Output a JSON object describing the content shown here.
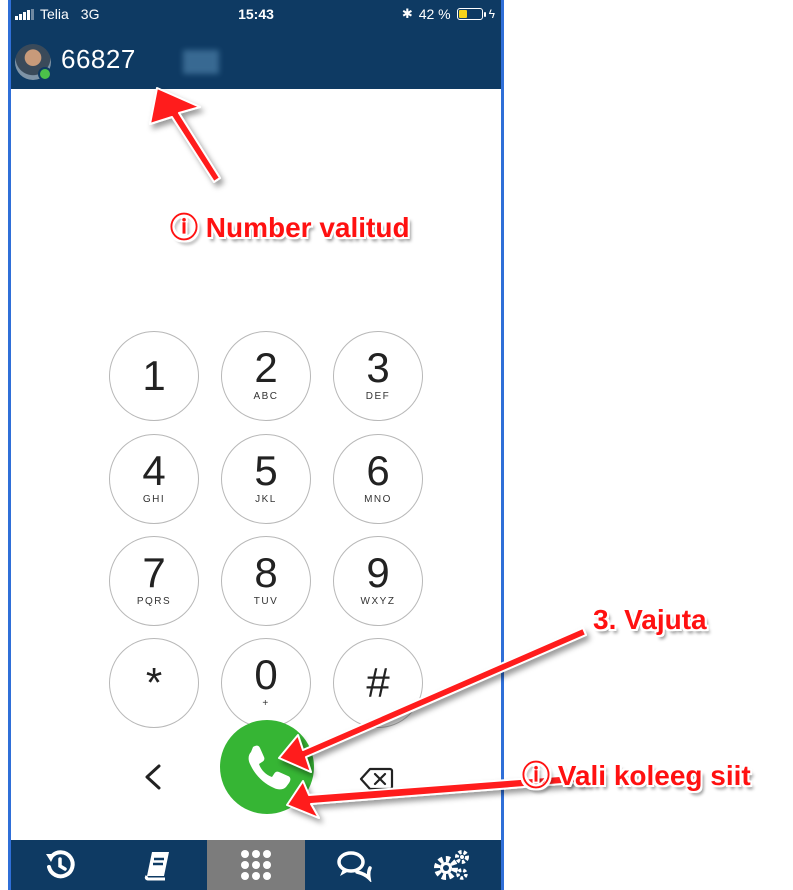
{
  "status_bar": {
    "carrier": "Telia",
    "network": "3G",
    "time": "15:43",
    "battery_percent": "42 %",
    "battery_level": 0.42
  },
  "header": {
    "dialed_number": "66827"
  },
  "keypad": {
    "keys": [
      {
        "digit": "1",
        "letters": ""
      },
      {
        "digit": "2",
        "letters": "ABC"
      },
      {
        "digit": "3",
        "letters": "DEF"
      },
      {
        "digit": "4",
        "letters": "GHI"
      },
      {
        "digit": "5",
        "letters": "JKL"
      },
      {
        "digit": "6",
        "letters": "MNO"
      },
      {
        "digit": "7",
        "letters": "PQRS"
      },
      {
        "digit": "8",
        "letters": "TUV"
      },
      {
        "digit": "9",
        "letters": "WXYZ"
      },
      {
        "digit": "*",
        "letters": ""
      },
      {
        "digit": "0",
        "letters": "+"
      },
      {
        "digit": "#",
        "letters": ""
      }
    ]
  },
  "actions": {
    "back_icon": "chevron-left-icon",
    "call_icon": "phone-icon",
    "delete_icon": "backspace-icon"
  },
  "tabs": [
    {
      "icon": "history-icon",
      "active": false
    },
    {
      "icon": "contacts-book-icon",
      "active": false
    },
    {
      "icon": "dialpad-icon",
      "active": true
    },
    {
      "icon": "chat-icon",
      "active": false
    },
    {
      "icon": "settings-gears-icon",
      "active": false
    }
  ],
  "annotations": {
    "number_selected": "ⓘ Number valitud",
    "press": "3. Vajuta",
    "choose_colleague": "ⓘ Vali koleeg siit"
  },
  "colors": {
    "header": "#0e3a63",
    "call_button": "#36b534",
    "annotation": "#ff1111",
    "active_tab": "#7c7c7c"
  }
}
